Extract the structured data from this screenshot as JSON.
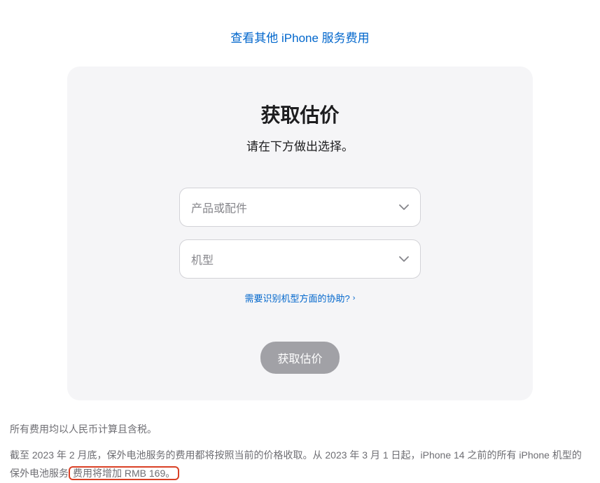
{
  "topLink": {
    "text": "查看其他 iPhone 服务费用"
  },
  "card": {
    "title": "获取估价",
    "subtitle": "请在下方做出选择。",
    "productSelect": {
      "placeholder": "产品或配件"
    },
    "modelSelect": {
      "placeholder": "机型"
    },
    "helpLink": {
      "text": "需要识别机型方面的协助?"
    },
    "submitButton": {
      "label": "获取估价"
    }
  },
  "footer": {
    "line1": "所有费用均以人民币计算且含税。",
    "line2Part1": "截至 2023 年 2 月底，保外电池服务的费用都将按照当前的价格收取。从 2023 年 3 月 1 日起，iPhone 14 之前的所有 iPhone 机型的保外电池服务",
    "line2Highlight": "费用将增加 RMB 169。"
  }
}
